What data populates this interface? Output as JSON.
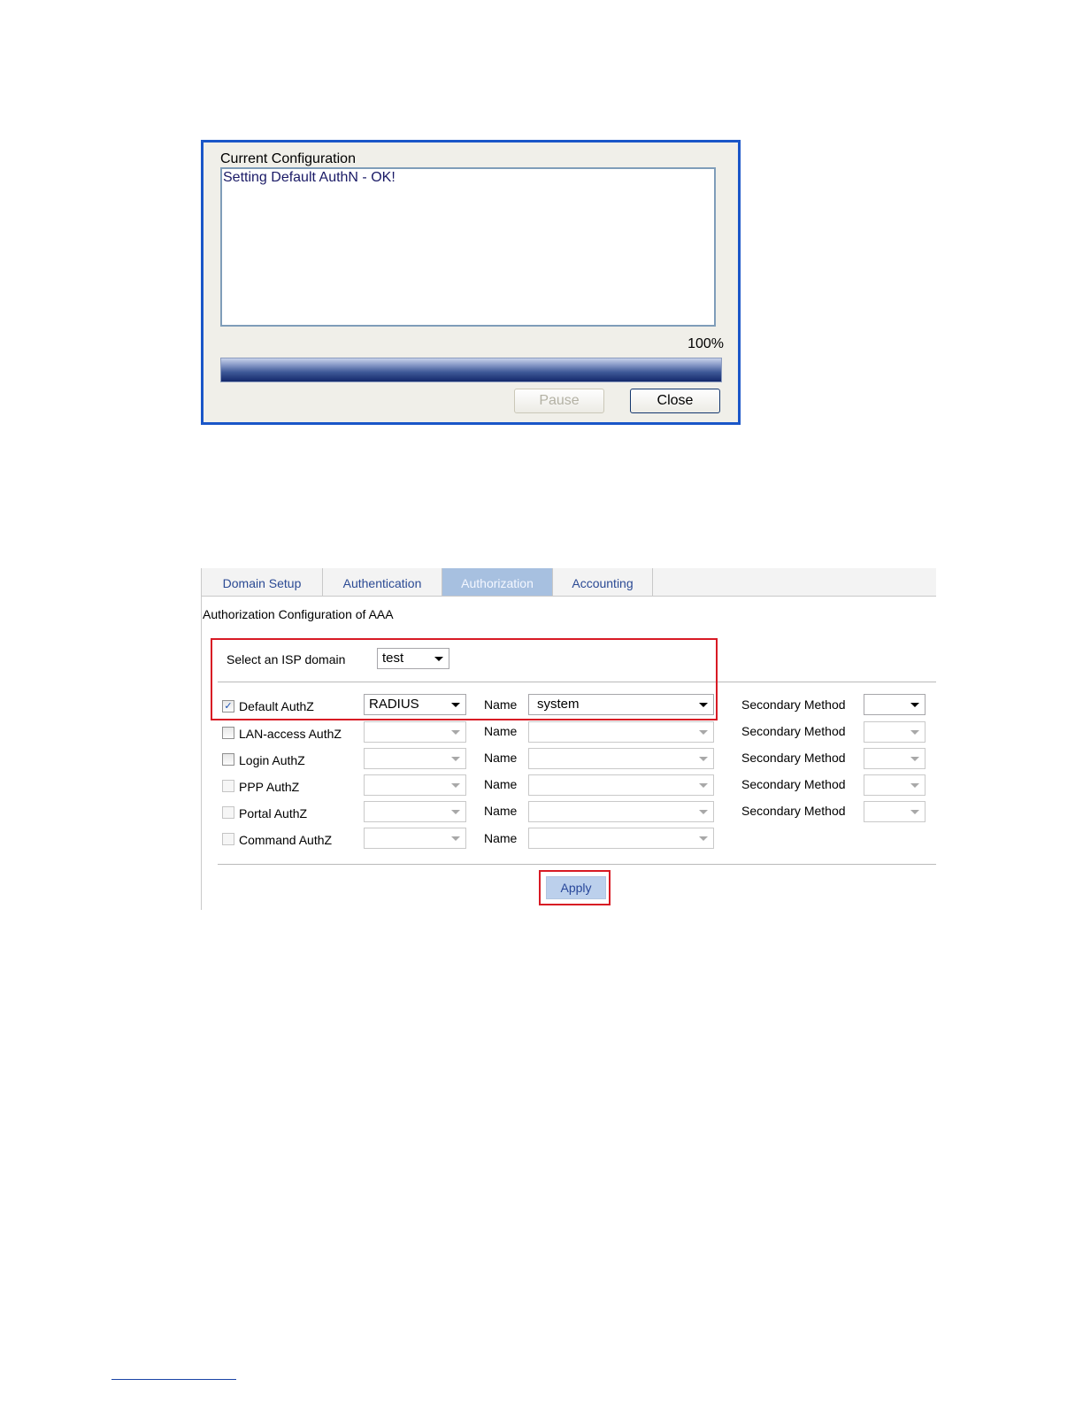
{
  "dialog": {
    "title": "Current Configuration",
    "log_text": "Setting Default AuthN - OK!",
    "progress_label": "100%",
    "progress": 1.0,
    "pause_label": "Pause",
    "close_label": "Close"
  },
  "tabs": [
    {
      "label": "Domain Setup",
      "active": false
    },
    {
      "label": "Authentication",
      "active": false
    },
    {
      "label": "Authorization",
      "active": true
    },
    {
      "label": "Accounting",
      "active": false
    }
  ],
  "section_title": "Authorization Configuration of AAA",
  "isp": {
    "label": "Select an ISP domain",
    "value": "test"
  },
  "name_label": "Name",
  "secondary_label": "Secondary Method",
  "rows": [
    {
      "label": "Default AuthZ",
      "checked": true,
      "method": "RADIUS",
      "name": "system",
      "secondary": ""
    },
    {
      "label": "LAN-access AuthZ",
      "checked": false,
      "method": "",
      "name": "",
      "secondary": ""
    },
    {
      "label": "Login AuthZ",
      "checked": false,
      "method": "",
      "name": "",
      "secondary": ""
    },
    {
      "label": "PPP AuthZ",
      "checked": false,
      "method": "",
      "name": "",
      "secondary": ""
    },
    {
      "label": "Portal AuthZ",
      "checked": false,
      "method": "",
      "name": "",
      "secondary": ""
    },
    {
      "label": "Command AuthZ",
      "checked": false,
      "method": "",
      "name": ""
    }
  ],
  "apply_label": "Apply",
  "colors": {
    "highlight": "#d81a24",
    "dialog_border": "#1a56c8",
    "tab_active": "#a7c0e0",
    "tab_text": "#2b4a94"
  }
}
